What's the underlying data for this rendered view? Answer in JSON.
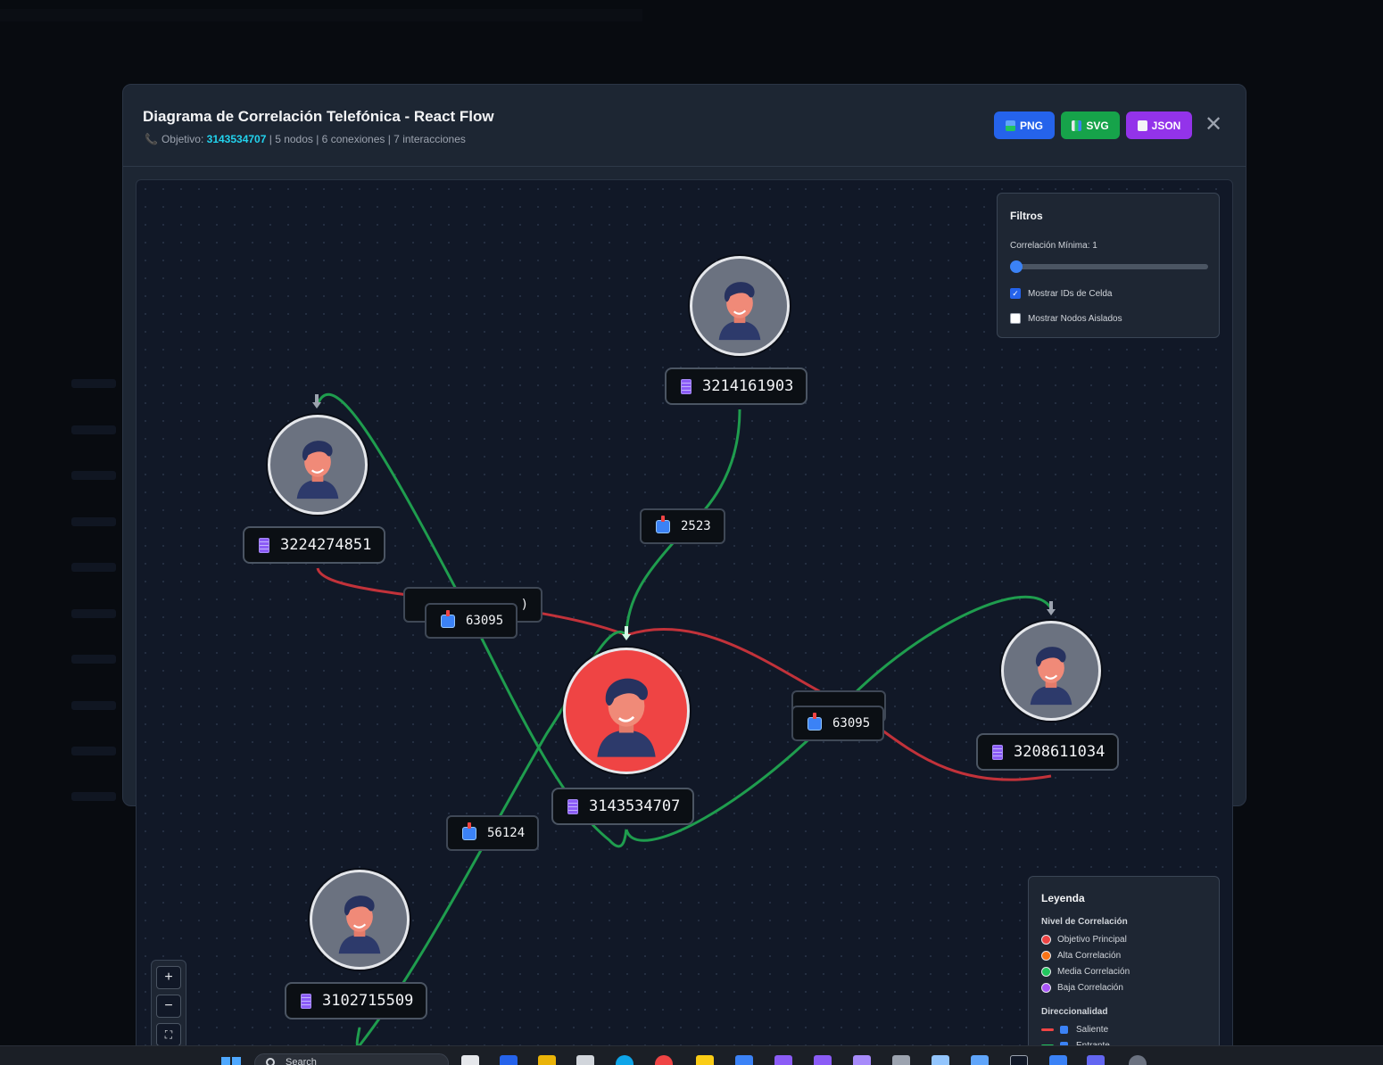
{
  "modal": {
    "title": "Diagrama de Correlación Telefónica - React Flow",
    "subtitle_prefix": "Objetivo: ",
    "target_number": "3143534707",
    "subtitle_stats": " | 5 nodos | 6 conexiones | 7 interacciones",
    "buttons": {
      "png": "PNG",
      "svg": "SVG",
      "json": "JSON"
    },
    "close_label": "✕"
  },
  "nodes": [
    {
      "id": "main",
      "number": "3143534707",
      "level": "Objetivo Principal"
    },
    {
      "id": "n1",
      "number": "3214161903"
    },
    {
      "id": "n2",
      "number": "3224274851"
    },
    {
      "id": "n3",
      "number": "3208611034"
    },
    {
      "id": "n4",
      "number": "3102715509"
    }
  ],
  "edge_labels": {
    "e1": "2523",
    "e2": "63095",
    "e2_hidden": ")",
    "e3": "63095",
    "e4": "56124"
  },
  "filters": {
    "title": "Filtros",
    "min_correlation_label": "Correlación Mínima: 1",
    "min_correlation_value": 1,
    "show_cell_ids_label": "Mostrar IDs de Celda",
    "show_cell_ids": true,
    "show_isolated_label": "Mostrar Nodos Aislados",
    "show_isolated": false
  },
  "legend": {
    "title": "Leyenda",
    "level_section": "Nivel de Correlación",
    "levels": [
      {
        "label": "Objetivo Principal",
        "color": "#ef4444"
      },
      {
        "label": "Alta Correlación",
        "color": "#f97316"
      },
      {
        "label": "Media Correlación",
        "color": "#22c55e"
      },
      {
        "label": "Baja Correlación",
        "color": "#a855f7"
      }
    ],
    "direction_section": "Direccionalidad",
    "directions": [
      {
        "label": "Saliente",
        "color": "#ef4444"
      },
      {
        "label": "Entrante",
        "color": "#22c55e"
      }
    ]
  },
  "controls": {
    "zoom_in": "+",
    "zoom_out": "−",
    "fit": "⛶"
  },
  "colors": {
    "outgoing": "#ef4444",
    "incoming": "#22c55e",
    "accent": "#22d3ee"
  },
  "taskbar": {
    "search_placeholder": "Search"
  }
}
